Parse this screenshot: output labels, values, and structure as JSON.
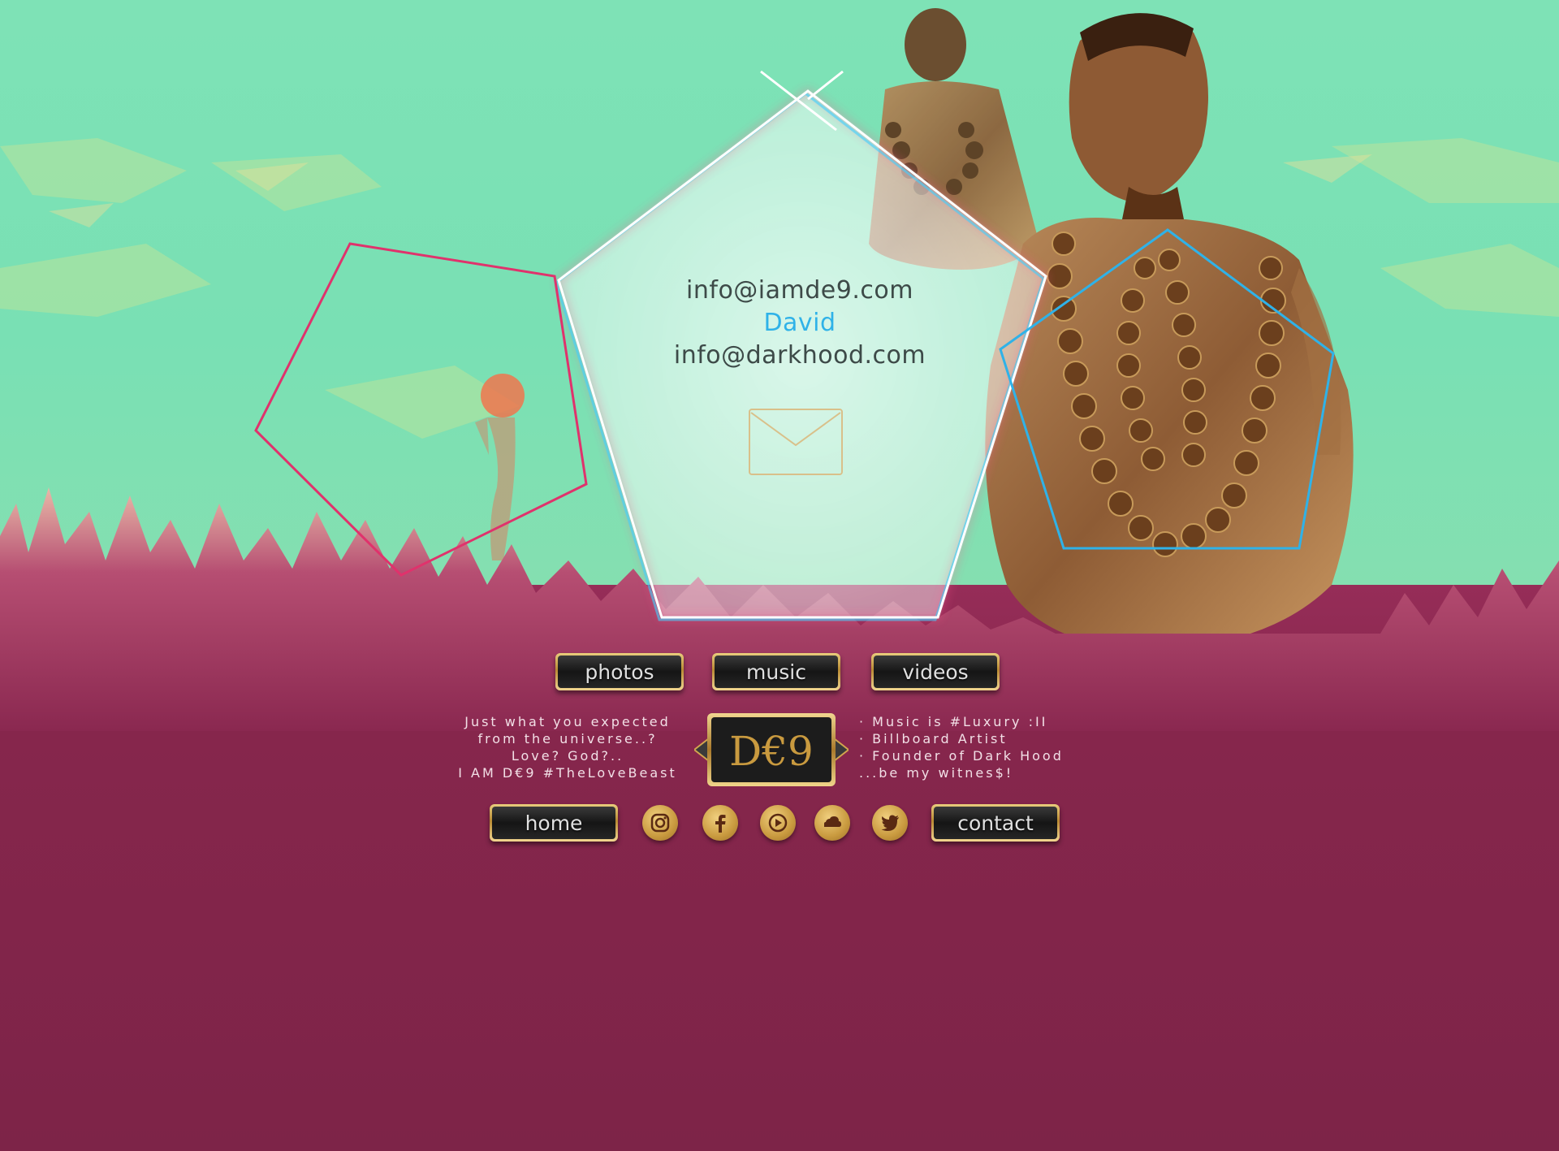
{
  "contact": {
    "email_primary": "info@iamde9.com",
    "name": "David",
    "email_secondary": "info@darkhood.com"
  },
  "nav_top": {
    "photos": "photos",
    "music": "music",
    "videos": "videos"
  },
  "nav_bottom": {
    "home": "home",
    "contact": "contact"
  },
  "tagline_left": [
    "Just what you expected",
    "from the universe..?",
    "Love? God?..",
    "I AM D€9 #TheLoveBeast"
  ],
  "tagline_right": [
    "· Music is #Luxury :II",
    "· Billboard Artist",
    "· Founder of Dark Hood",
    "...be my witnes$!"
  ],
  "logo": {
    "text": "D€9"
  },
  "social": [
    "instagram-icon",
    "facebook-icon",
    "youtube-icon",
    "soundcloud-icon",
    "twitter-icon"
  ],
  "colors": {
    "sky": "#7ee2b6",
    "ground": "#7d2448",
    "accent_blue": "#2fb2e8",
    "accent_pink": "#e0326c",
    "gold": "#c99a3f"
  }
}
